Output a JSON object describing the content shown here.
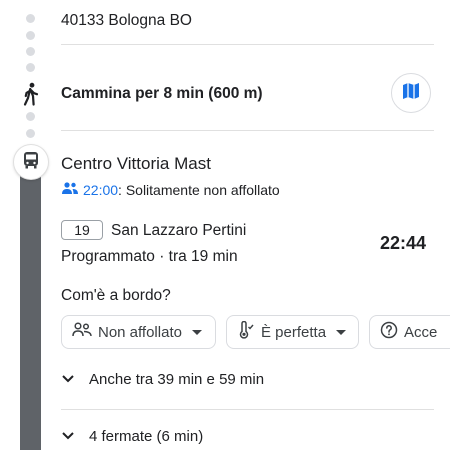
{
  "address_line": "40133 Bologna BO",
  "walk": {
    "text": "Cammina per 8 min (600 m)",
    "icon": "walk-icon",
    "map_button_icon": "map-icon"
  },
  "stop": {
    "name": "Centro Vittoria Mast",
    "crowd_time": "22:00",
    "crowd_text": ": Solitamente non affollato",
    "route_number": "19",
    "destination": "San Lazzaro Pertini",
    "departure_time": "22:44",
    "status": "Programmato · tra 19 min"
  },
  "onboard": {
    "question": "Com'è a bordo?",
    "chips": [
      {
        "label": "Non affollato",
        "icon": "crowd-icon"
      },
      {
        "label": "È perfetta",
        "icon": "thermometer-icon"
      },
      {
        "label": "Acce",
        "icon": "accessibility-question-icon"
      }
    ]
  },
  "also": "Anche tra 39 min e 59 min",
  "stops_summary": "4 fermate (6 min)",
  "colors": {
    "accent": "#1a73e8",
    "rail": "#5f6368",
    "dots": "#dadce0",
    "text": "#202124"
  }
}
